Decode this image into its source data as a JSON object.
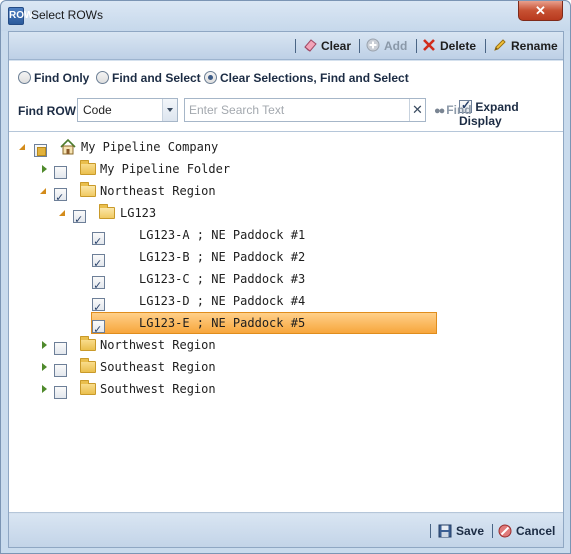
{
  "window": {
    "title": "Select ROWs",
    "app_icon": "ROW",
    "close_glyph": "✕"
  },
  "toolbar": {
    "clear_label": "Clear",
    "add_label": "Add",
    "delete_label": "Delete",
    "rename_label": "Rename"
  },
  "options": {
    "radios": [
      {
        "label": "Find Only",
        "selected": false
      },
      {
        "label": "Find and Select",
        "selected": false
      },
      {
        "label": "Clear Selections, Find and Select",
        "selected": true
      }
    ],
    "expand_display": {
      "label": "Expand Display",
      "checked": true
    }
  },
  "search": {
    "find_label": "Find ROW",
    "field_value": "Code",
    "placeholder": "Enter Search Text",
    "clear_glyph": "✕",
    "find_button": "Find"
  },
  "tree": {
    "root": "My Pipeline Company",
    "folder": "My Pipeline Folder",
    "northeast": "Northeast Region",
    "lg123": "LG123",
    "items": [
      "LG123-A ; NE Paddock #1",
      "LG123-B ; NE Paddock #2",
      "LG123-C ; NE Paddock #3",
      "LG123-D ; NE Paddock #4",
      "LG123-E ; NE Paddock #5"
    ],
    "northwest": "Northwest Region",
    "southeast": "Southeast Region",
    "southwest": "Southwest Region"
  },
  "footer": {
    "save_label": "Save",
    "cancel_label": "Cancel"
  },
  "colors": {
    "selection": "#f7a63c",
    "chrome": "#c9dbed",
    "folder": "#eabf4d"
  }
}
